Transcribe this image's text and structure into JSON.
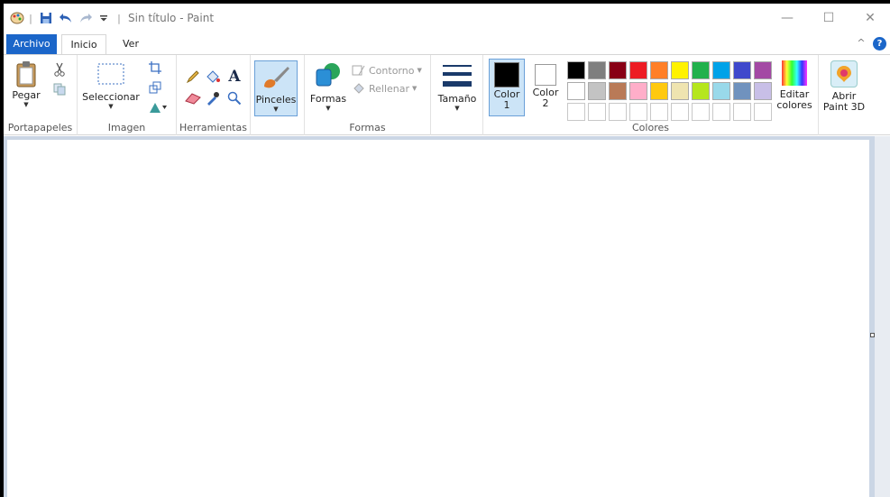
{
  "title_bar": {
    "title": "Sin título - Paint",
    "qa_separator": "|",
    "controls": {
      "minimize": "—",
      "maximize": "☐",
      "close": "✕"
    }
  },
  "tabs": [
    {
      "label": "Archivo"
    },
    {
      "label": "Inicio"
    },
    {
      "label": "Ver"
    }
  ],
  "ribbon": {
    "collapse_glyph": "^",
    "help_glyph": "?",
    "groups": {
      "clipboard": {
        "label": "Portapapeles",
        "paste": "Pegar"
      },
      "image": {
        "label": "Imagen",
        "select": "Seleccionar"
      },
      "tools": {
        "label": "Herramientas",
        "text_glyph": "A"
      },
      "brushes": {
        "label": "Pinceles"
      },
      "shapes": {
        "label": "Formas",
        "shapes_button": "Formas",
        "outline": "Contorno",
        "fill": "Rellenar"
      },
      "size": {
        "label": "Tamaño"
      },
      "colors": {
        "label": "Colores",
        "color1_line1": "Color",
        "color1_line2": "1",
        "color2_line1": "Color",
        "color2_line2": "2",
        "color1_value": "#000000",
        "color2_value": "#ffffff",
        "palette_row1": [
          "#000000",
          "#7f7f7f",
          "#880015",
          "#ed1c24",
          "#ff7f27",
          "#fff200",
          "#22b14c",
          "#00a2e8",
          "#3f48cc",
          "#a349a4"
        ],
        "palette_row2": [
          "#ffffff",
          "#c3c3c3",
          "#b97a57",
          "#ffaec9",
          "#ffc90e",
          "#efe4b0",
          "#b5e61d",
          "#99d9ea",
          "#7092be",
          "#c8bfe7"
        ],
        "palette_row3_empty_count": 10,
        "edit_line1": "Editar",
        "edit_line2": "colores"
      },
      "paint3d": {
        "line1": "Abrir",
        "line2": "Paint 3D"
      }
    }
  },
  "accent": "#1b66c9"
}
